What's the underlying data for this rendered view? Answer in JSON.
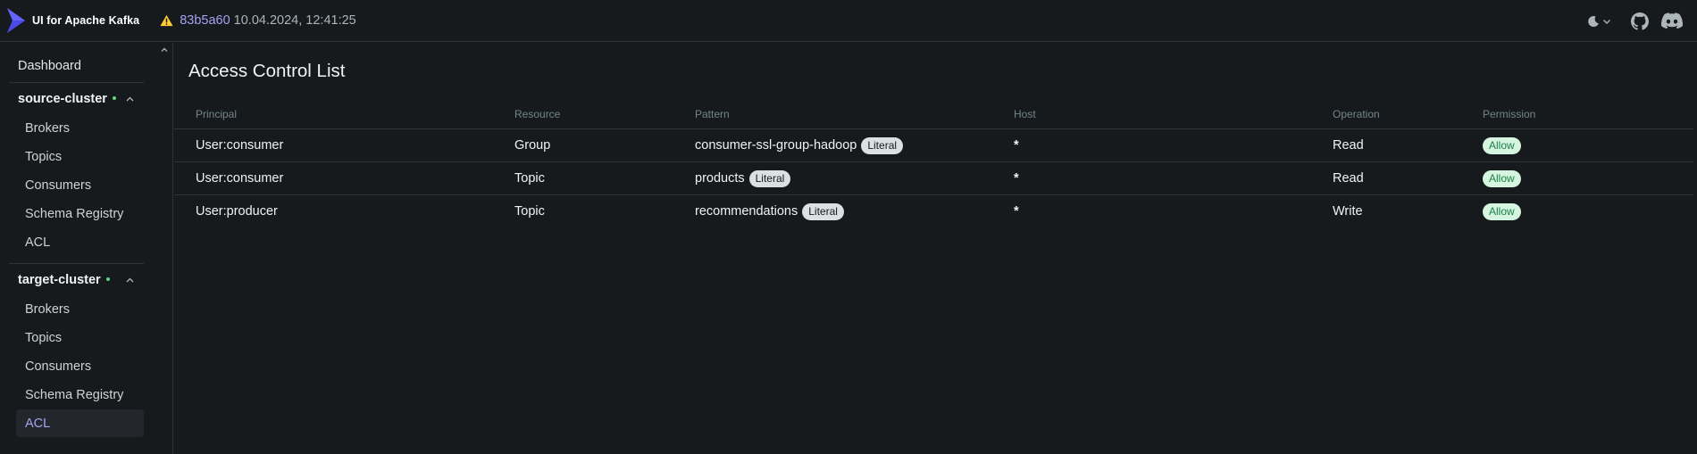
{
  "app": {
    "title": "UI for Apache Kafka",
    "commit": "83b5a60",
    "build_date": "10.04.2024, 12:41:25"
  },
  "sidebar": {
    "dashboard": "Dashboard",
    "clusters": [
      {
        "name": "source-cluster",
        "status": "online",
        "items": [
          "Brokers",
          "Topics",
          "Consumers",
          "Schema Registry",
          "ACL"
        ]
      },
      {
        "name": "target-cluster",
        "status": "online",
        "items": [
          "Brokers",
          "Topics",
          "Consumers",
          "Schema Registry",
          "ACL"
        ],
        "active_item": "ACL"
      }
    ]
  },
  "main": {
    "title": "Access Control List",
    "columns": [
      "Principal",
      "Resource",
      "Pattern",
      "Host",
      "Operation",
      "Permission"
    ],
    "rows": [
      {
        "principal": "User:consumer",
        "resource": "Group",
        "pattern": "consumer-ssl-group-hadoop",
        "pattern_type": "Literal",
        "host": "*",
        "operation": "Read",
        "permission": "Allow"
      },
      {
        "principal": "User:consumer",
        "resource": "Topic",
        "pattern": "products",
        "pattern_type": "Literal",
        "host": "*",
        "operation": "Read",
        "permission": "Allow"
      },
      {
        "principal": "User:producer",
        "resource": "Topic",
        "pattern": "recommendations",
        "pattern_type": "Literal",
        "host": "*",
        "operation": "Write",
        "permission": "Allow"
      }
    ]
  },
  "icons": {
    "logo": "kafka-ui-logo",
    "warning": "warning-icon",
    "theme": "moon-icon",
    "github": "github-icon",
    "discord": "discord-icon"
  },
  "colors": {
    "background": "#171a1c",
    "accent": "#a3a3f5",
    "status_online": "#5cd685",
    "warning": "#ffcc33",
    "allow_bg": "#d6f5e0",
    "allow_text": "#1a7f46"
  }
}
